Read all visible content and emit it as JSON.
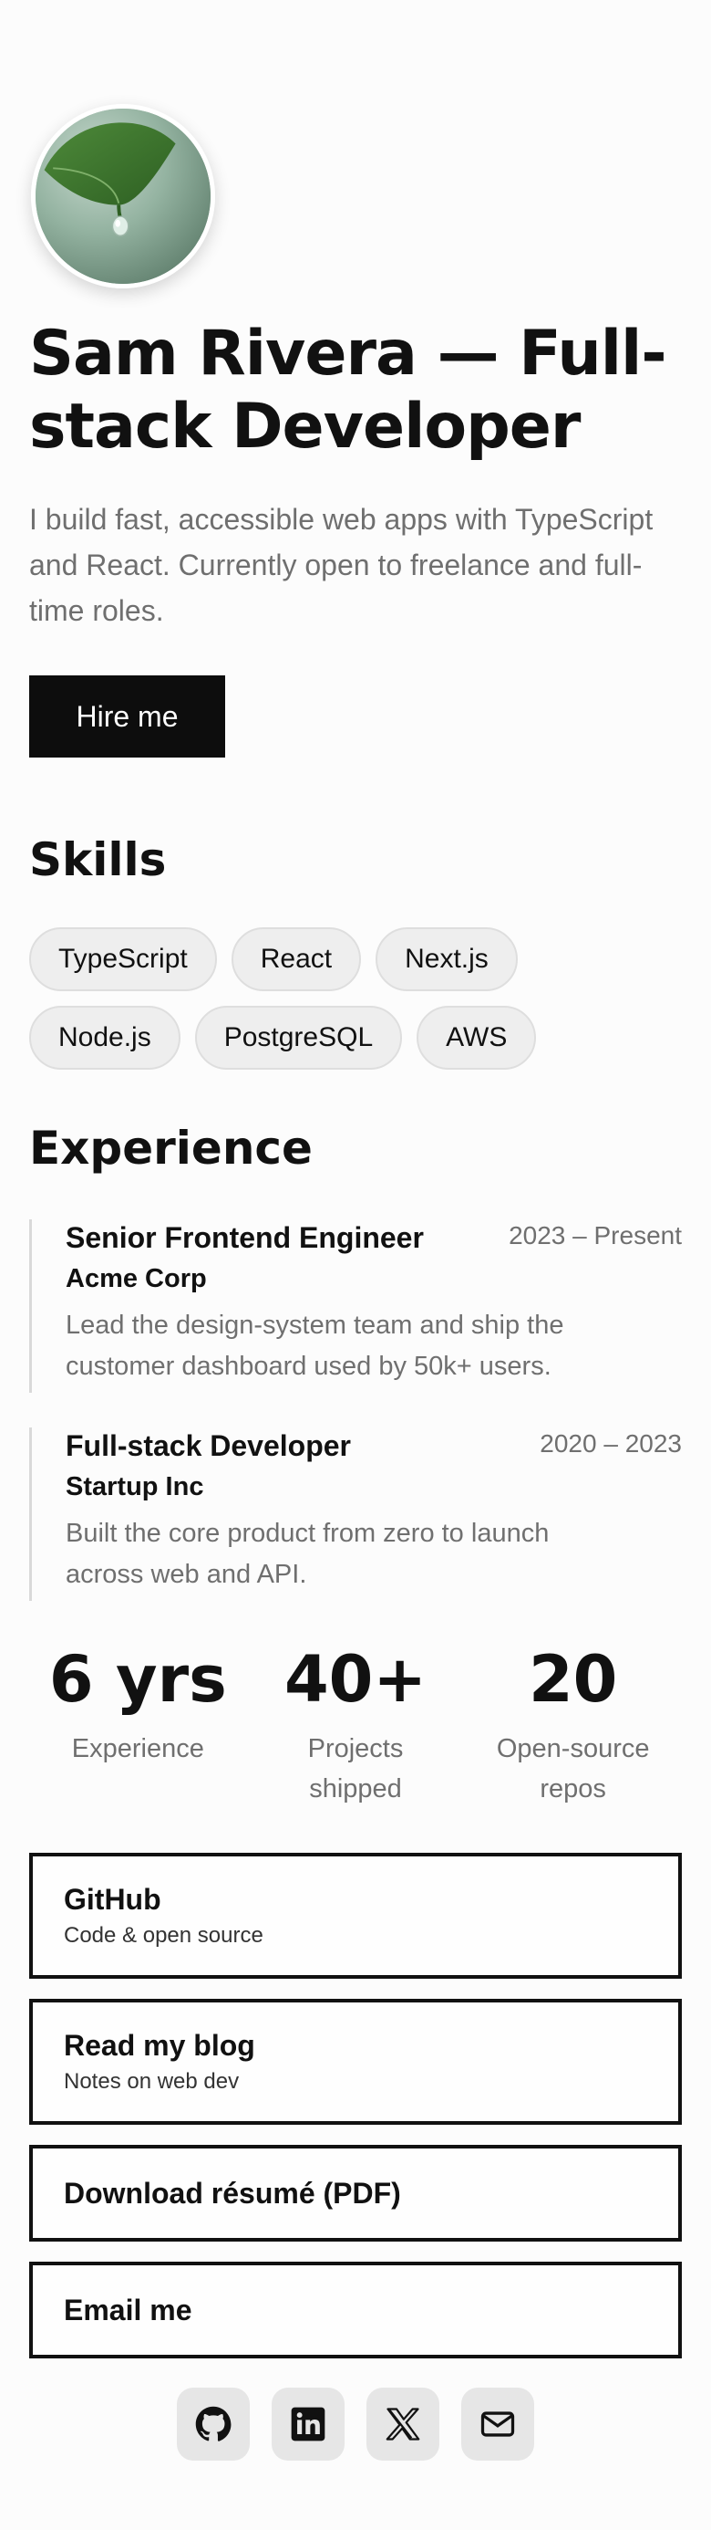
{
  "profile": {
    "title": "Sam Rivera — Full-stack Developer",
    "bio": "I build fast, accessible web apps with TypeScript and React. Currently open to freelance and full-time roles.",
    "cta_label": "Hire me"
  },
  "skills": {
    "heading": "Skills",
    "items": [
      "TypeScript",
      "React",
      "Next.js",
      "Node.js",
      "PostgreSQL",
      "AWS"
    ]
  },
  "experience": {
    "heading": "Experience",
    "items": [
      {
        "role": "Senior Frontend Engineer",
        "company": "Acme Corp",
        "dates": "2023 – Present",
        "description": "Lead the design-system team and ship the customer dashboard used by 50k+ users."
      },
      {
        "role": "Full-stack Developer",
        "company": "Startup Inc",
        "dates": "2020 – 2023",
        "description": "Built the core product from zero to launch across web and API."
      }
    ]
  },
  "stats": [
    {
      "value": "6 yrs",
      "label": "Experience"
    },
    {
      "value": "40+",
      "label": "Projects shipped"
    },
    {
      "value": "20",
      "label": "Open-source repos"
    }
  ],
  "links": [
    {
      "title": "GitHub",
      "subtitle": "Code & open source"
    },
    {
      "title": "Read my blog",
      "subtitle": "Notes on web dev"
    },
    {
      "title": "Download résumé (PDF)"
    },
    {
      "title": "Email me"
    }
  ],
  "socials": [
    {
      "icon": "github-icon"
    },
    {
      "icon": "linkedin-icon"
    },
    {
      "icon": "x-icon"
    },
    {
      "icon": "mail-icon"
    }
  ],
  "colors": {
    "background": "#fcfcfc",
    "text": "#111111",
    "muted": "#6f6f6f",
    "button": "#0d0d0d",
    "chip": "#eeeeee",
    "social_bg": "#e6e6e6"
  }
}
